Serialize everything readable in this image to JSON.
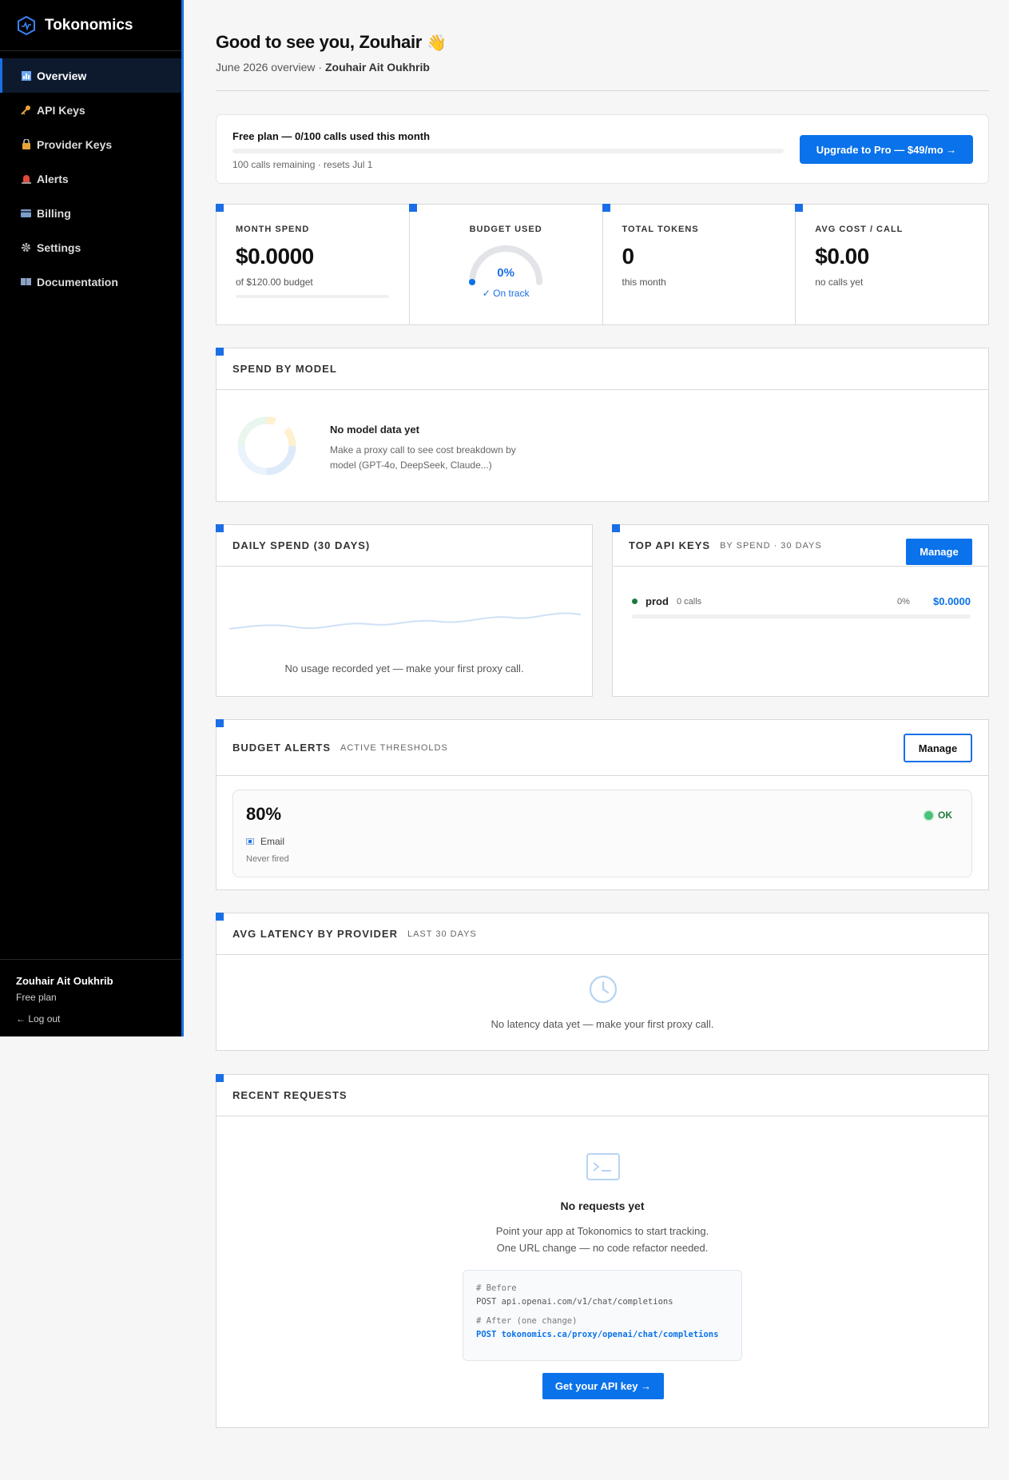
{
  "app": {
    "name": "Tokonomics"
  },
  "sidebar": {
    "items": [
      {
        "label": "Overview",
        "icon": "chart-icon",
        "active": true
      },
      {
        "label": "API Keys",
        "icon": "key-icon"
      },
      {
        "label": "Provider Keys",
        "icon": "lock-icon"
      },
      {
        "label": "Alerts",
        "icon": "siren-icon"
      },
      {
        "label": "Billing",
        "icon": "card-icon"
      },
      {
        "label": "Settings",
        "icon": "gear-icon"
      },
      {
        "label": "Documentation",
        "icon": "book-icon"
      }
    ],
    "user": {
      "name": "Zouhair Ait Oukhrib",
      "plan": "Free plan",
      "logout": "← Log out"
    }
  },
  "header": {
    "greeting": "Good to see you, Zouhair",
    "wave": "👋",
    "subtitle_prefix": "June 2026 overview ·",
    "subtitle_name": "Zouhair Ait Oukhrib"
  },
  "plan": {
    "title": "Free plan — 0/100 calls used this month",
    "usage_fraction": 0,
    "sub": "100 calls remaining · resets Jul 1",
    "upgrade_label": "Upgrade to Pro — $49/mo →"
  },
  "stats": {
    "month_spend": {
      "label": "MONTH SPEND",
      "value": "$0.0000",
      "sub": "of $120.00 budget",
      "fraction": 0
    },
    "budget_used": {
      "label": "BUDGET USED",
      "value": "0%",
      "status": "✓ On track",
      "fraction": 0
    },
    "total_tokens": {
      "label": "TOTAL TOKENS",
      "value": "0",
      "sub": "this month"
    },
    "avg_cost": {
      "label": "AVG COST / CALL",
      "value": "$0.00",
      "sub": "no calls yet"
    }
  },
  "spend_by_model": {
    "title": "SPEND BY MODEL",
    "empty_title": "No model data yet",
    "empty_text": "Make a proxy call to see cost breakdown by model (GPT-4o, DeepSeek, Claude...)"
  },
  "daily_spend": {
    "title": "DAILY SPEND (30 DAYS)",
    "empty_text": "No usage recorded yet — make your first proxy call."
  },
  "top_keys": {
    "title": "TOP API KEYS",
    "tag": "BY SPEND · 30 DAYS",
    "manage_label": "Manage",
    "rows": [
      {
        "name": "prod",
        "calls": "0 calls",
        "pct": "0%",
        "amount": "$0.0000",
        "fraction": 0
      }
    ]
  },
  "alerts": {
    "title": "BUDGET ALERTS",
    "tag": "ACTIVE THRESHOLDS",
    "manage_label": "Manage",
    "items": [
      {
        "threshold": "80%",
        "channel": "Email",
        "status": "Never fired",
        "badge": "OK"
      }
    ]
  },
  "latency": {
    "title": "AVG LATENCY BY PROVIDER",
    "tag": "LAST 30 DAYS",
    "empty_text": "No latency data yet — make your first proxy call."
  },
  "recent": {
    "title": "RECENT REQUESTS",
    "empty_title": "No requests yet",
    "empty_line1": "Point your app at Tokonomics to start tracking.",
    "empty_line2": "One URL change — no code refactor needed.",
    "code": {
      "before_comment": "# Before",
      "before_line": "POST api.openai.com/v1/chat/completions",
      "after_comment": "# After (one change)",
      "after_line": "POST tokonomics.ca/proxy/openai/chat/completions"
    },
    "cta_label": "Get your API key →"
  },
  "colors": {
    "accent": "#0a72ea",
    "sidebar_bg": "#000000",
    "ok": "#4bc27a"
  }
}
